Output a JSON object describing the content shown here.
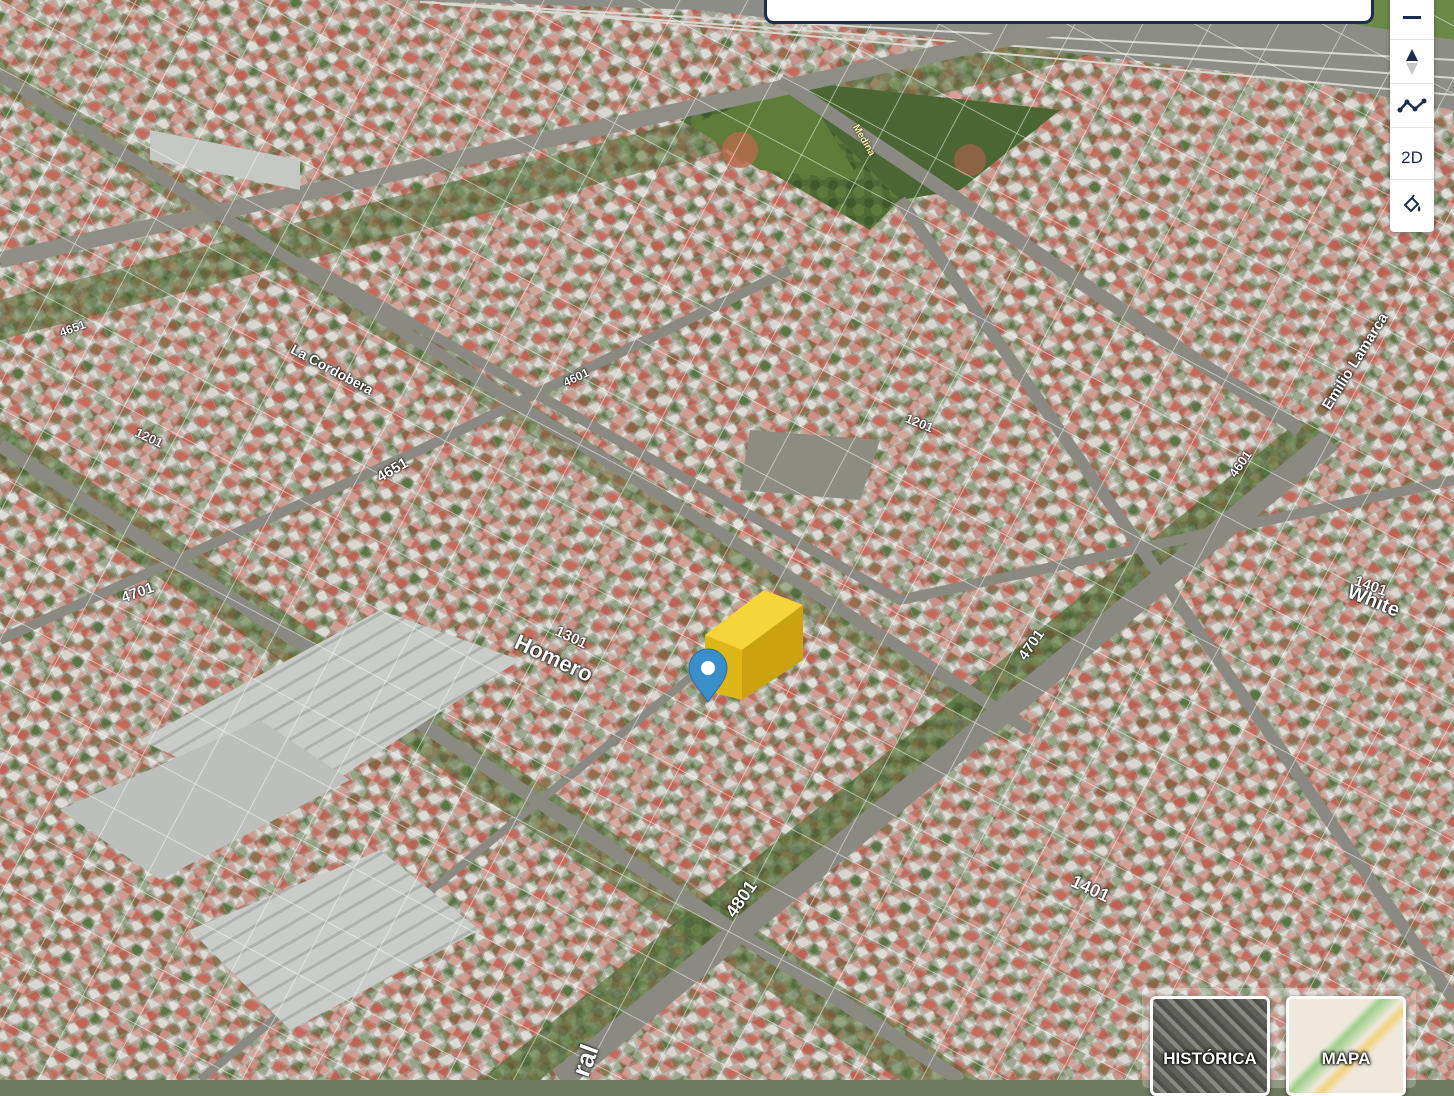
{
  "map": {
    "street_labels": [
      {
        "name": "homero-street-label",
        "text": "Homero"
      },
      {
        "name": "white-street-label",
        "text": "White"
      },
      {
        "name": "medina-street-label",
        "text": "Medina"
      },
      {
        "name": "cordobera-street-label",
        "text": "La Cordobera"
      },
      {
        "name": "emilio-lamarca-street-label",
        "text": "Emilio Lamarca"
      },
      {
        "name": "corral-street-label",
        "text": "ral"
      }
    ],
    "number_labels": [
      "1301",
      "4701",
      "4801",
      "1401",
      "1401",
      "4701",
      "4651",
      "4651",
      "1201",
      "4601",
      "1201",
      "4601"
    ],
    "colors": {
      "building_highlight": "#e8c21a",
      "marker": "#3a8ec9",
      "panel_border": "#1d2b4f"
    }
  },
  "toolbar": {
    "zoom_out_icon": "minus-icon",
    "compass_icon": "compass-icon",
    "measure_icon": "polyline-icon",
    "view_mode_label": "2D",
    "style_icon": "paint-bucket-icon"
  },
  "base_layers": {
    "historic_label": "HISTÓRICA",
    "map_label": "MAPA"
  }
}
